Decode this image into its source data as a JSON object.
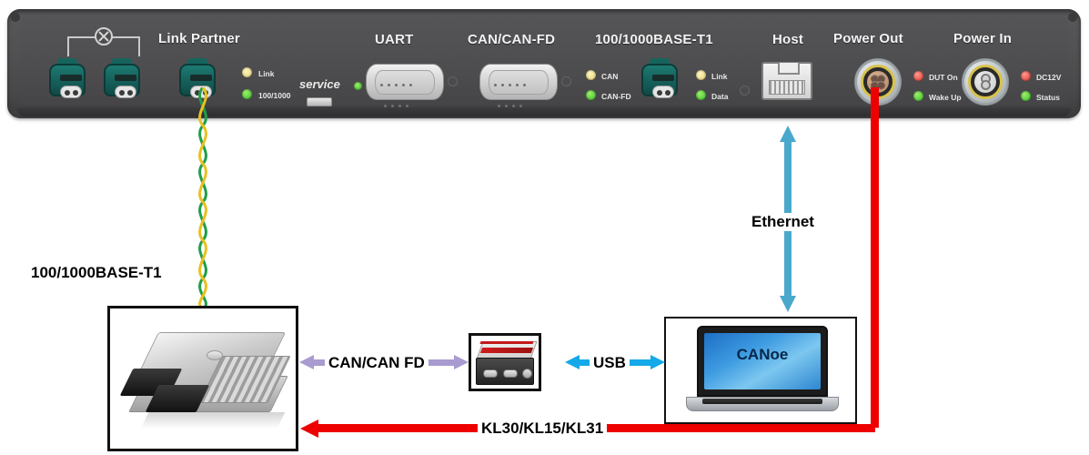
{
  "device": {
    "name": "network-interface-panel",
    "sections": [
      {
        "label": "Link Partner"
      },
      {
        "label": "UART"
      },
      {
        "label": "CAN/CAN-FD"
      },
      {
        "label": "100/1000BASE-T1"
      },
      {
        "label": "Host"
      },
      {
        "label": "Power Out"
      },
      {
        "label": "Power In"
      }
    ],
    "service_label": "service",
    "leds": {
      "link_partner": [
        {
          "label": "Link",
          "color": "#e8d879",
          "state": "yellow"
        },
        {
          "label": "100/1000",
          "color": "#39c22c",
          "state": "green"
        }
      ],
      "can": [
        {
          "label": "CAN",
          "color": "#e8d879",
          "state": "yellow"
        },
        {
          "label": "CAN-FD",
          "color": "#39c22c",
          "state": "green"
        }
      ],
      "base_t1": [
        {
          "label": "Link",
          "color": "#e8d879",
          "state": "yellow"
        },
        {
          "label": "Data",
          "color": "#39c22c",
          "state": "green"
        }
      ],
      "power_out": [
        {
          "label": "DUT On",
          "color": "#e33a2e",
          "state": "red"
        },
        {
          "label": "Wake Up",
          "color": "#39c22c",
          "state": "green"
        }
      ],
      "power_in": [
        {
          "label": "DC12V",
          "color": "#e33a2e",
          "state": "red"
        },
        {
          "label": "Status",
          "color": "#39c22c",
          "state": "green"
        }
      ]
    }
  },
  "diagram": {
    "ecu_label": "100/1000BASE-T1",
    "laptop_screen_label": "CANoe",
    "connections": [
      {
        "label": "Ethernet",
        "color": "#4aa8cc",
        "orientation": "vertical"
      },
      {
        "label": "CAN/CAN FD",
        "color": "#a99bd0",
        "orientation": "horizontal"
      },
      {
        "label": "USB",
        "color": "#14a9e8",
        "orientation": "horizontal"
      },
      {
        "label": "KL30/KL15/KL31",
        "color": "#ee0000",
        "orientation": "horizontal"
      }
    ],
    "cable": {
      "name": "twisted-pair",
      "colors": [
        "#1f9e4a",
        "#e8c120"
      ]
    }
  },
  "colors": {
    "panel": "#4e4e50",
    "ethernet_arrow": "#4aa8cc",
    "can_arrow": "#a99bd0",
    "usb_arrow": "#14a9e8",
    "power_line": "#ee0000"
  }
}
